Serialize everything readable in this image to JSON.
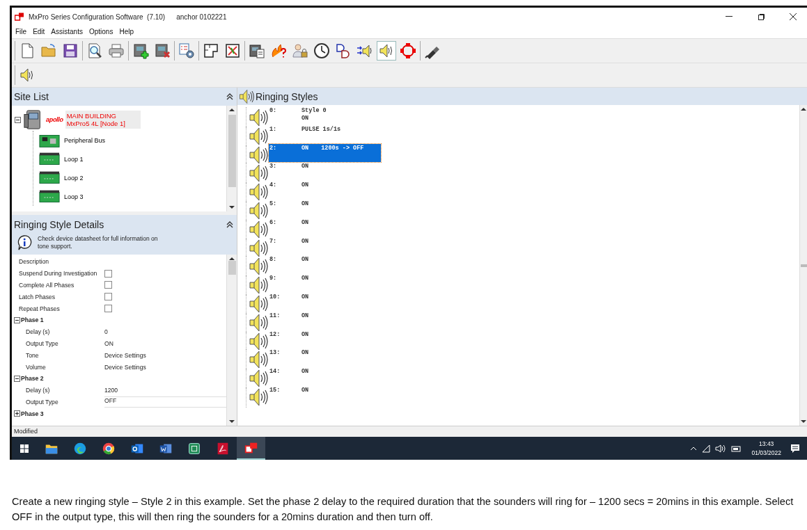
{
  "window": {
    "title": "MxPro Series Configuration Software  (7.10)",
    "user": "anchor 0102221"
  },
  "menu": [
    "File",
    "Edit",
    "Assistants",
    "Options",
    "Help"
  ],
  "toolbar": [
    [
      {
        "kind": "new",
        "selected": false
      },
      {
        "kind": "open",
        "selected": false
      },
      {
        "kind": "save",
        "selected": false
      }
    ],
    [
      {
        "kind": "preview",
        "selected": false
      },
      {
        "kind": "print",
        "selected": false
      }
    ],
    [
      {
        "kind": "add-panel",
        "selected": false
      },
      {
        "kind": "remove-panel",
        "selected": false
      }
    ],
    [
      {
        "kind": "config",
        "selected": false
      }
    ],
    [
      {
        "kind": "layout",
        "selected": false
      },
      {
        "kind": "clear",
        "selected": false
      }
    ],
    [
      {
        "kind": "panel-doc",
        "selected": false
      },
      {
        "kind": "fire-help",
        "selected": false
      },
      {
        "kind": "user-lock",
        "selected": false
      },
      {
        "kind": "clock",
        "selected": false
      },
      {
        "kind": "logic",
        "selected": false
      },
      {
        "kind": "sounder-in",
        "selected": false
      },
      {
        "kind": "sounder",
        "selected": true
      },
      {
        "kind": "network",
        "selected": false
      }
    ],
    [
      {
        "kind": "usb",
        "selected": false
      }
    ]
  ],
  "toolbar2": [
    {
      "kind": "sounder",
      "selected": false
    }
  ],
  "site_list": {
    "title": "Site List",
    "tree": [
      {
        "kind": "panel",
        "brand": "apollo",
        "label": "MAIN BUILDING",
        "sublabel": "MxPro5 4L [Node 1]",
        "expanded": true,
        "selected": true,
        "children": [
          {
            "kind": "bus",
            "label": "Peripheral Bus",
            "selected": false
          },
          {
            "kind": "loop",
            "label": "Loop 1",
            "selected": false
          },
          {
            "kind": "loop",
            "label": "Loop 2",
            "selected": false
          },
          {
            "kind": "loop",
            "label": "Loop 3",
            "selected": false
          }
        ]
      }
    ]
  },
  "details": {
    "title": "Ringing Style Details",
    "info": "Check device datasheet for full information on tone support.",
    "properties": [
      {
        "kind": "text",
        "label": "Description"
      },
      {
        "kind": "checkbox",
        "label": "Suspend During Investigation",
        "checked": false
      },
      {
        "kind": "checkbox",
        "label": "Complete All Phases",
        "checked": false
      },
      {
        "kind": "checkbox",
        "label": "Latch Phases",
        "checked": false
      },
      {
        "kind": "checkbox",
        "label": "Repeat Phases",
        "checked": false
      },
      {
        "kind": "group",
        "label": "Phase 1",
        "expanded": true,
        "children": [
          {
            "label": "Delay (s)",
            "value": "0"
          },
          {
            "label": "Output Type",
            "value": "ON"
          },
          {
            "label": "Tone",
            "value": "Device Settings"
          },
          {
            "label": "Volume",
            "value": "Device Settings"
          }
        ]
      },
      {
        "kind": "group",
        "label": "Phase 2",
        "expanded": true,
        "children": [
          {
            "label": "Delay (s)",
            "value": "1200"
          },
          {
            "label": "Output Type",
            "value": "OFF"
          }
        ]
      },
      {
        "kind": "group",
        "label": "Phase 3",
        "expanded": false
      }
    ]
  },
  "ringing_styles": {
    "title": "Ringing Styles",
    "items": [
      {
        "number": "0:",
        "name": "Style 0",
        "output": "ON",
        "selected": false
      },
      {
        "number": "1:",
        "output": "PULSE 1s/1s",
        "selected": false
      },
      {
        "number": "2:",
        "output": "ON",
        "detail": "1200s -> OFF",
        "selected": true
      },
      {
        "number": "3:",
        "output": "ON",
        "selected": false
      },
      {
        "number": "4:",
        "output": "ON",
        "selected": false
      },
      {
        "number": "5:",
        "output": "ON",
        "selected": false
      },
      {
        "number": "6:",
        "output": "ON",
        "selected": false
      },
      {
        "number": "7:",
        "output": "ON",
        "selected": false
      },
      {
        "number": "8:",
        "output": "ON",
        "selected": false
      },
      {
        "number": "9:",
        "output": "ON",
        "selected": false
      },
      {
        "number": "10:",
        "output": "ON",
        "selected": false
      },
      {
        "number": "11:",
        "output": "ON",
        "selected": false
      },
      {
        "number": "12:",
        "output": "ON",
        "selected": false
      },
      {
        "number": "13:",
        "output": "ON",
        "selected": false
      },
      {
        "number": "14:",
        "output": "ON",
        "selected": false
      },
      {
        "number": "15:",
        "output": "ON",
        "selected": false
      }
    ]
  },
  "status_bar": "Modified",
  "taskbar": {
    "apps": [
      {
        "kind": "folder",
        "selected": false
      },
      {
        "kind": "edge",
        "selected": false
      },
      {
        "kind": "chrome",
        "selected": false
      },
      {
        "kind": "outlook",
        "selected": false
      },
      {
        "kind": "word",
        "selected": false
      },
      {
        "kind": "sheet",
        "selected": false
      },
      {
        "kind": "pdf",
        "selected": false
      },
      {
        "kind": "mxpro",
        "selected": true
      }
    ],
    "time": "13:43",
    "date": "01/03/2022"
  },
  "caption": "Create a new ringing style – Style 2 in this example. Set the phase 2 delay to the required duration that the sounders will ring for – 1200 secs = 20mins in this example. Select OFF in the output type, this will then ring the sounders for a 20mins duration and then turn off."
}
